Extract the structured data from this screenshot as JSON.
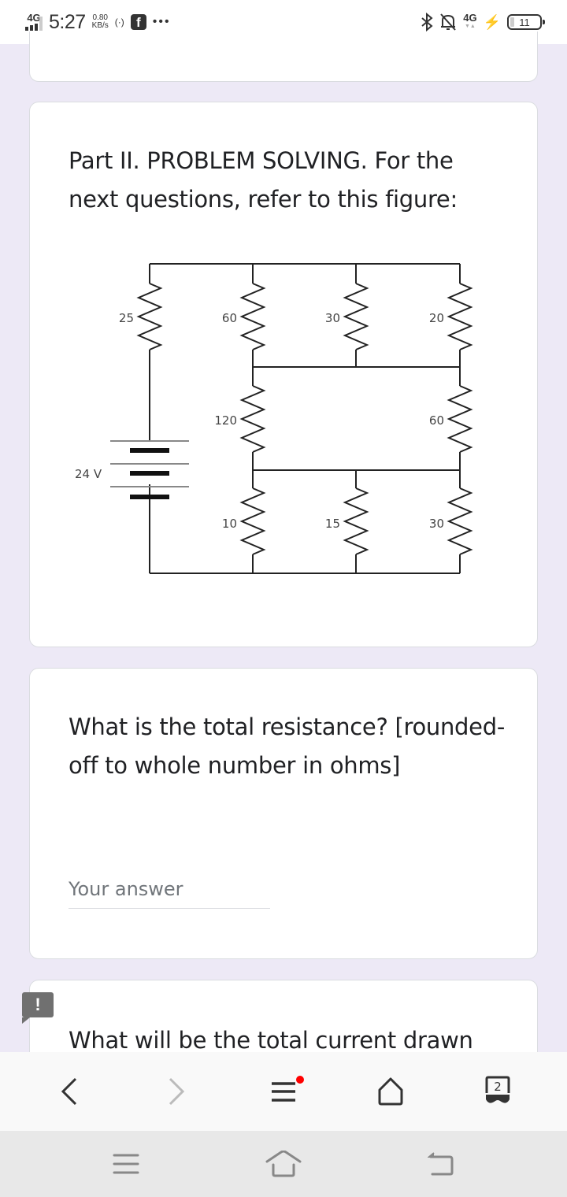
{
  "status_bar": {
    "network": "4G",
    "time": "5:27",
    "speed_value": "0.80",
    "speed_unit": "KB/s",
    "hotspot_label": "(·)",
    "facebook_label": "f",
    "more": "•••",
    "bluetooth": "✱",
    "bell": "🔕",
    "lte": "4G",
    "battery_level": "11"
  },
  "cards": {
    "figure_card": {
      "title": "Part II. PROBLEM SOLVING. For the next questions, refer to this figure:"
    },
    "question1": {
      "title": "What is the total resistance? [rounded-off to whole number in ohms]",
      "answer_placeholder": "Your answer",
      "answer_value": ""
    },
    "question2": {
      "title": "What will be the total current drawn"
    }
  },
  "circuit": {
    "battery_label": "24 V",
    "resistors": {
      "r_top_left": "25",
      "r_top_2": "60",
      "r_top_3": "30",
      "r_top_4": "20",
      "r_mid_left": "120",
      "r_mid_right": "60",
      "r_bot_1": "10",
      "r_bot_2": "15",
      "r_bot_3": "30"
    }
  },
  "flag_label": "!",
  "browser_bar": {
    "tabs_count": "2"
  }
}
